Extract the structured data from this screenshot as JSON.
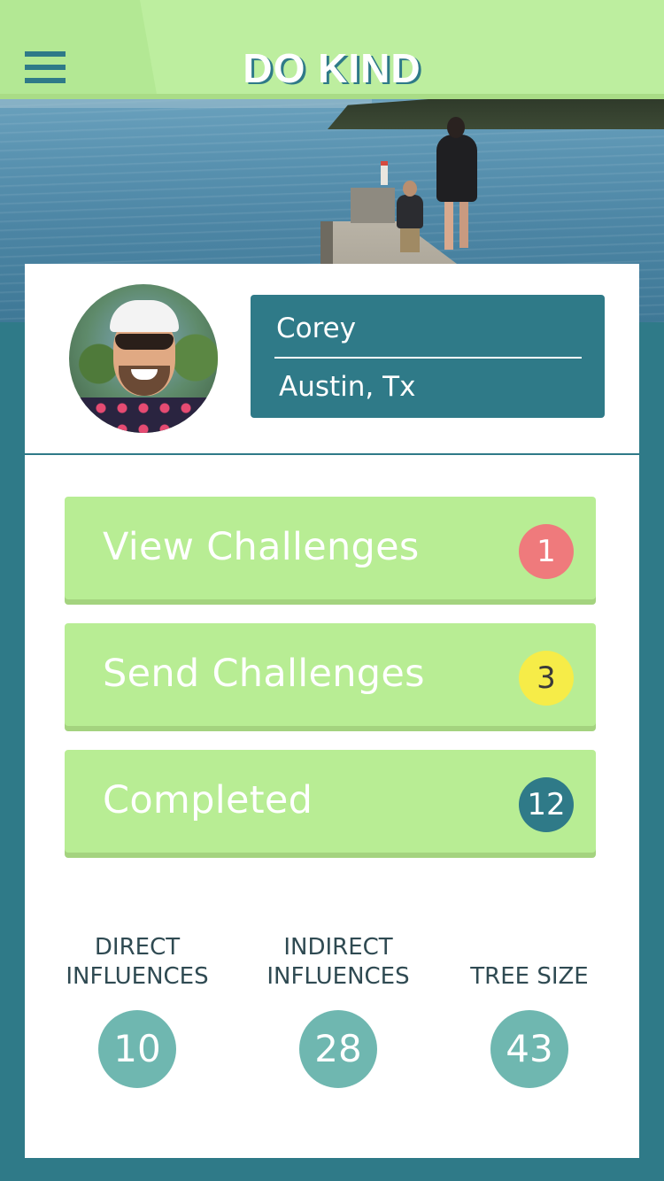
{
  "header": {
    "title": "DO KIND",
    "menu_icon": "hamburger-menu-icon"
  },
  "profile": {
    "name": "Corey",
    "location": "Austin, Tx"
  },
  "challenges": [
    {
      "label": "View Challenges",
      "count": "1",
      "badge_color": "#ef7a7c"
    },
    {
      "label": "Send Challenges",
      "count": "3",
      "badge_color": "#f6ec48"
    },
    {
      "label": "Completed",
      "count": "12",
      "badge_color": "#2f7a88"
    }
  ],
  "stats": [
    {
      "label_line1": "DIRECT",
      "label_line2": "INFLUENCES",
      "value": "10"
    },
    {
      "label_line1": "INDIRECT",
      "label_line2": "INFLUENCES",
      "value": "28"
    },
    {
      "label_line1": "",
      "label_line2": "TREE SIZE",
      "value": "43"
    }
  ],
  "colors": {
    "header_green": "#bdee9f",
    "button_green": "#b8ed94",
    "teal": "#2f7a88",
    "stat_circle": "#6fb7b0"
  }
}
